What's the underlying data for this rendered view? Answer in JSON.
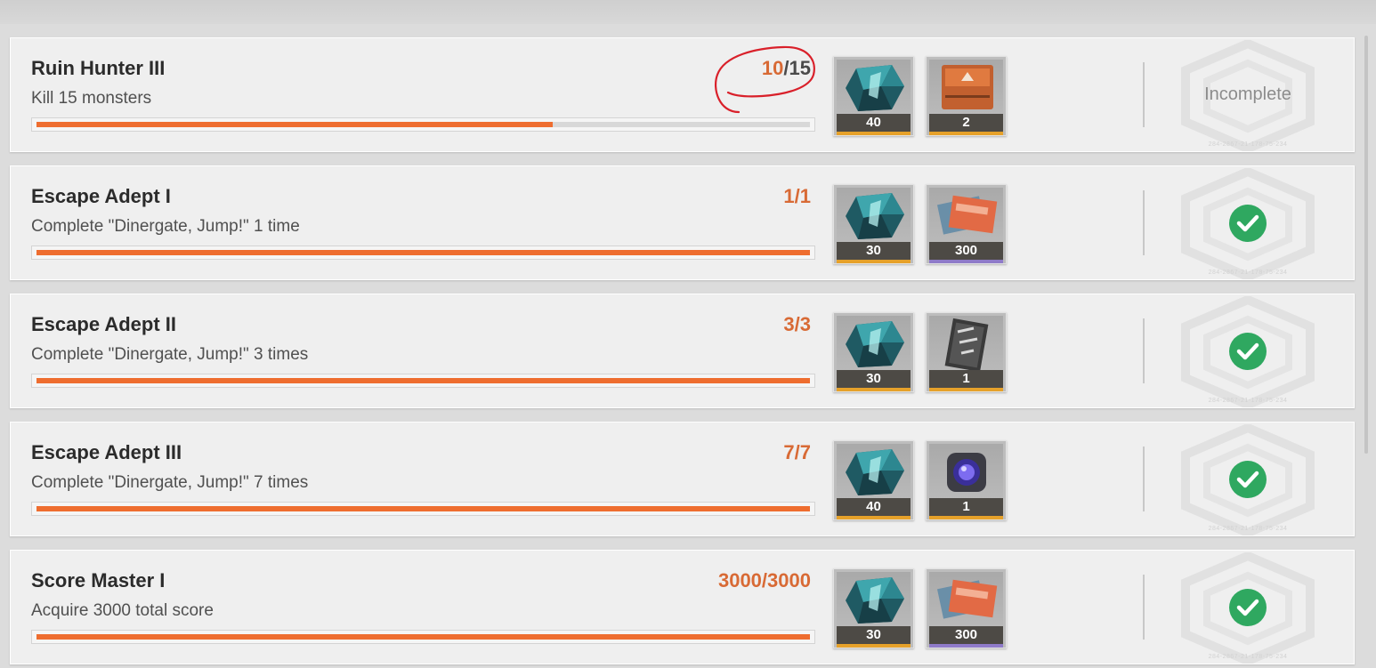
{
  "colors": {
    "accent": "#ee6d2f",
    "progress_text": "#d86a35",
    "complete_check": "#2fa860",
    "rarity_orange": "#e6a12a",
    "rarity_purple": "#8f7bc9"
  },
  "quests": [
    {
      "title": "Ruin Hunter III",
      "description": "Kill 15 monsters",
      "progress_done": "10",
      "progress_sep": "/",
      "progress_total": "15",
      "progress_fraction": 0.667,
      "rewards": [
        {
          "icon": "crystal-icon",
          "qty": "40",
          "rarity": "orange"
        },
        {
          "icon": "data-card-icon",
          "qty": "2",
          "rarity": "orange"
        }
      ],
      "status": "Incomplete",
      "status_code": "284-2867-21-178-75-234",
      "completed": false
    },
    {
      "title": "Escape Adept I",
      "description": "Complete \"Dinergate, Jump!\" 1 time",
      "progress_done": "1",
      "progress_sep": "/",
      "progress_total": "1",
      "progress_fraction": 1,
      "rewards": [
        {
          "icon": "crystal-icon",
          "qty": "30",
          "rarity": "orange"
        },
        {
          "icon": "tickets-icon",
          "qty": "300",
          "rarity": "purple"
        }
      ],
      "status": "",
      "status_code": "284-2867-21-178-75-234",
      "completed": true
    },
    {
      "title": "Escape Adept II",
      "description": "Complete \"Dinergate, Jump!\" 3 times",
      "progress_done": "3",
      "progress_sep": "/",
      "progress_total": "3",
      "progress_fraction": 1,
      "rewards": [
        {
          "icon": "crystal-icon",
          "qty": "30",
          "rarity": "orange"
        },
        {
          "icon": "document-icon",
          "qty": "1",
          "rarity": "orange"
        }
      ],
      "status": "",
      "status_code": "284-2867-21-178-75-234",
      "completed": true
    },
    {
      "title": "Escape Adept III",
      "description": "Complete \"Dinergate, Jump!\" 7 times",
      "progress_done": "7",
      "progress_sep": "/",
      "progress_total": "7",
      "progress_fraction": 1,
      "rewards": [
        {
          "icon": "crystal-icon",
          "qty": "40",
          "rarity": "orange"
        },
        {
          "icon": "core-device-icon",
          "qty": "1",
          "rarity": "orange"
        }
      ],
      "status": "",
      "status_code": "284-2867-21-178-75-234",
      "completed": true
    },
    {
      "title": "Score Master I",
      "description": "Acquire 3000 total score",
      "progress_done": "3000",
      "progress_sep": "/",
      "progress_total": "3000",
      "progress_fraction": 1,
      "rewards": [
        {
          "icon": "crystal-icon",
          "qty": "30",
          "rarity": "orange"
        },
        {
          "icon": "tickets-icon",
          "qty": "300",
          "rarity": "purple"
        }
      ],
      "status": "",
      "status_code": "284-2867-21-178-75-234",
      "completed": true
    }
  ]
}
